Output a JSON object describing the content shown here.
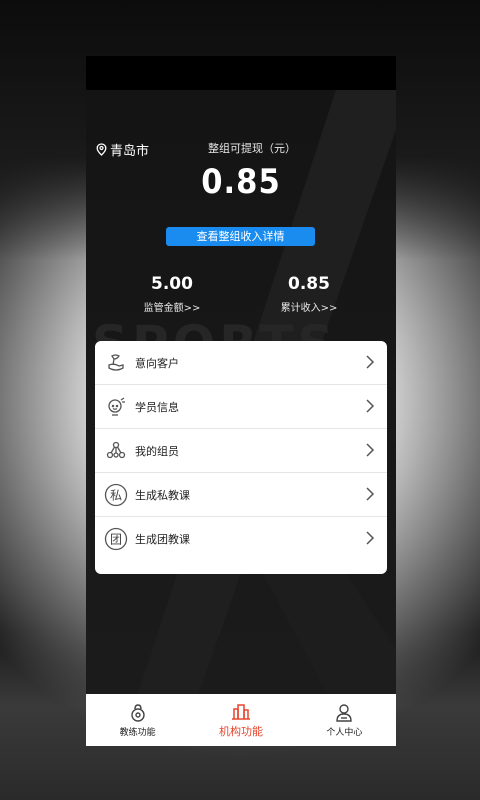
{
  "location": {
    "city": "青岛市",
    "icon": "location-pin-icon"
  },
  "balance": {
    "title": "整组可提现（元）",
    "value": "0.85"
  },
  "detail_button": {
    "label": "查看整组收入详情",
    "color": "#1a8cf0"
  },
  "stats": [
    {
      "value": "5.00",
      "label": "监管金额>>"
    },
    {
      "value": "0.85",
      "label": "累计收入>>"
    }
  ],
  "watermark": "SPORTS",
  "menu": [
    {
      "label": "意向客户",
      "icon": "intent-customer-icon"
    },
    {
      "label": "学员信息",
      "icon": "student-info-icon"
    },
    {
      "label": "我的组员",
      "icon": "team-members-icon"
    },
    {
      "label": "生成私教课",
      "icon": "private-class-icon",
      "glyph": "私"
    },
    {
      "label": "生成团教课",
      "icon": "group-class-icon",
      "glyph": "团"
    }
  ],
  "tabs": [
    {
      "label": "教练功能",
      "icon": "kettlebell-icon",
      "active": false
    },
    {
      "label": "机构功能",
      "icon": "building-icon",
      "active": true
    },
    {
      "label": "个人中心",
      "icon": "person-icon",
      "active": false
    }
  ],
  "colors": {
    "accent": "#e8452c",
    "primary_blue": "#1a8cf0",
    "hero_bg": "#161616"
  }
}
